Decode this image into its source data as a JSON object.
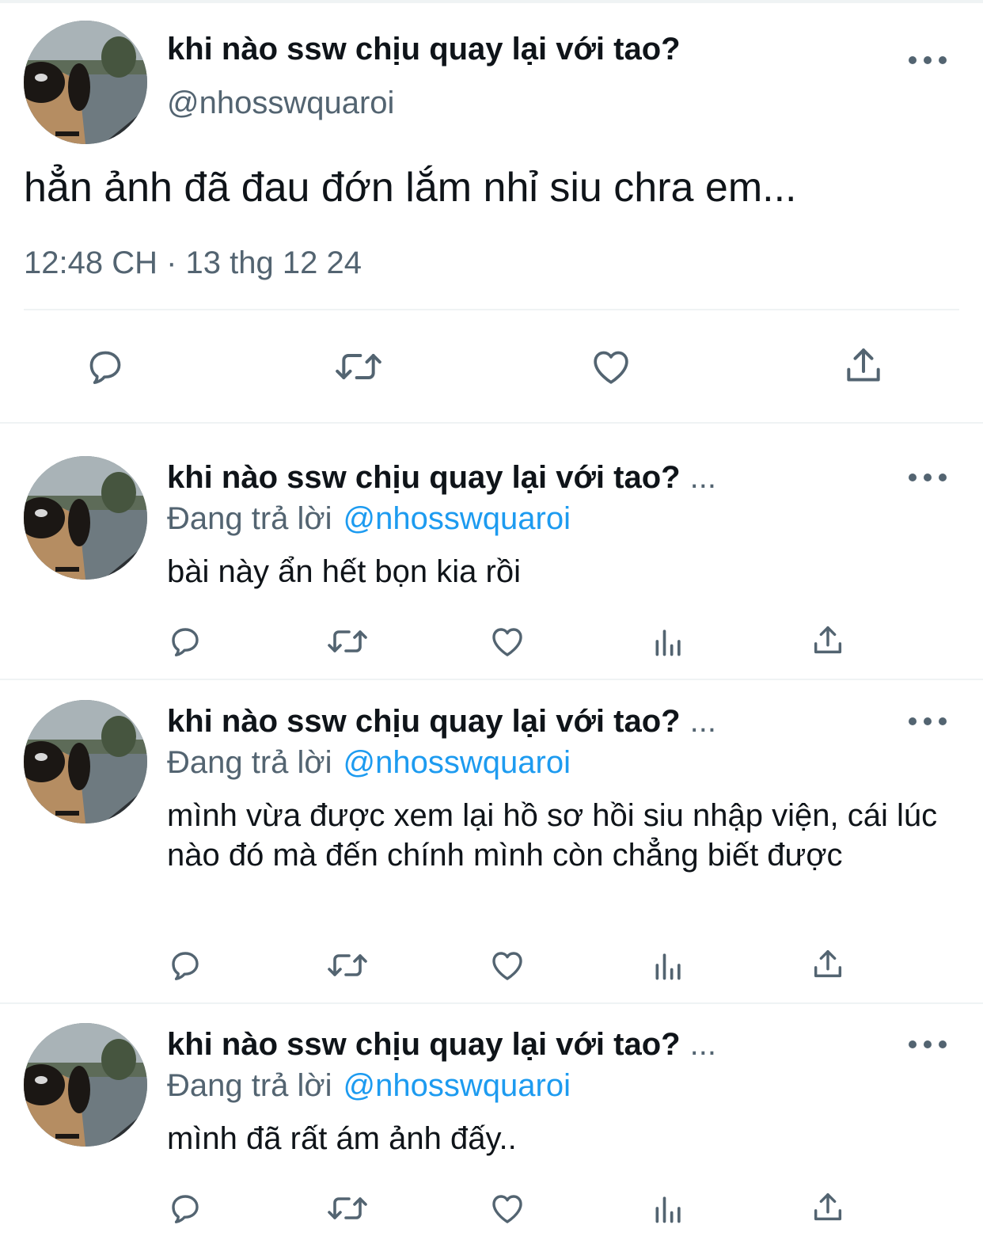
{
  "colors": {
    "text": "#0f1419",
    "secondary": "#536471",
    "link": "#1d9bf0",
    "divider": "#eff3f4"
  },
  "main_tweet": {
    "display_name": "khi nào ssw chịu quay lại với tao?",
    "handle": "@nhosswquaroi",
    "text": "hẳn ảnh đã đau đớn lắm nhỉ siu chra em...",
    "timestamp": "12:48 CH · 13 thg 12 24",
    "actions": [
      "reply-icon",
      "retweet-icon",
      "like-icon",
      "share-icon"
    ]
  },
  "replies": [
    {
      "display_name": "khi nào ssw chịu quay lại với tao?",
      "ellipsis": "...",
      "replying_label": "Đang trả lời",
      "mention": "@nhosswquaroi",
      "text": "bài này ẩn hết bọn kia rồi"
    },
    {
      "display_name": "khi nào ssw chịu quay lại với tao?",
      "ellipsis": "...",
      "replying_label": "Đang trả lời",
      "mention": "@nhosswquaroi",
      "text": "mình vừa được xem lại hồ sơ hồi siu nhập viện, cái lúc nào đó mà đến chính mình còn chẳng biết được"
    },
    {
      "display_name": "khi nào ssw chịu quay lại với tao?",
      "ellipsis": "...",
      "replying_label": "Đang trả lời",
      "mention": "@nhosswquaroi",
      "text": "mình đã rất ám ảnh đấy.."
    }
  ],
  "reply_actions": [
    "reply-icon",
    "retweet-icon",
    "like-icon",
    "analytics-icon",
    "share-icon"
  ]
}
